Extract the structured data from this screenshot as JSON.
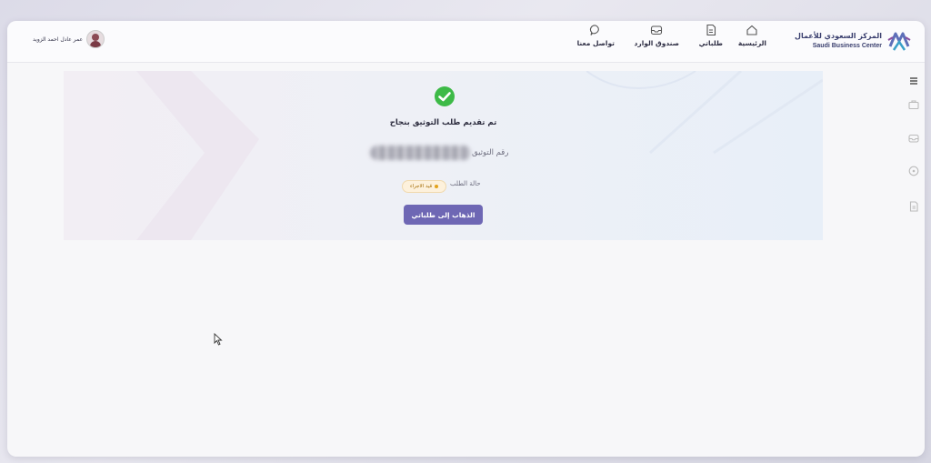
{
  "header": {
    "logo": {
      "arabic": "المركز السعودي للأعمال",
      "english": "Saudi Business Center",
      "icon": "saudi-business-center-logo"
    },
    "nav": [
      {
        "label": "الرئيسية",
        "icon": "home-icon"
      },
      {
        "label": "طلباتي",
        "icon": "document-icon"
      },
      {
        "label": "صندوق الوارد",
        "icon": "inbox-icon"
      },
      {
        "label": "تواصل معنا",
        "icon": "chat-icon"
      }
    ],
    "user": {
      "name": "عمر عادل احمد الزويد",
      "icon": "avatar"
    }
  },
  "banner": {
    "title": "تم تقديم طلب التوثيق بنجاح",
    "reference_label": "رقم التوثيق",
    "status_label": "حالة الطلب",
    "status_value": "قيد الاجراء",
    "button_label": "الذهاب إلى طلباتي",
    "success_icon": "check-circle-icon"
  },
  "sidebar": {
    "icons": [
      "menu-icon",
      "briefcase-icon",
      "inbox-icon",
      "circle-icon",
      "document-icon"
    ]
  },
  "colors": {
    "accent": "#6e67b4",
    "success": "#3dba47",
    "status_bg": "#fdf1dc",
    "status_text": "#a36a00"
  }
}
